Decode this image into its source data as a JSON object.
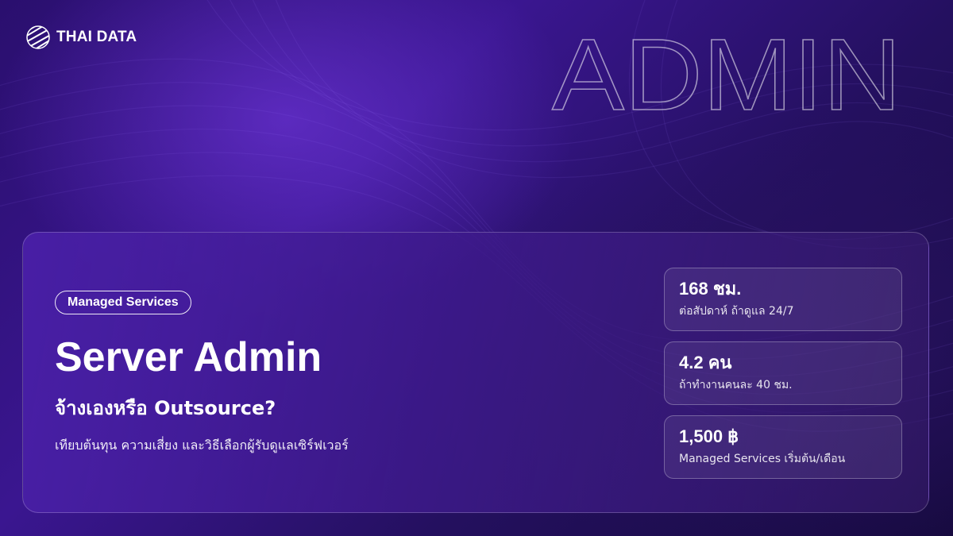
{
  "brand": {
    "name": "THAI DATA",
    "logo_icon": "globe-stripes-icon"
  },
  "watermark": {
    "text": "ADMIN"
  },
  "hero": {
    "tag": "Managed Services",
    "title": "Server Admin",
    "subtitle": "จ้างเองหรือ Outsource?",
    "description": "เทียบต้นทุน ความเสี่ยง และวิธีเลือกผู้รับดูแลเซิร์ฟเวอร์"
  },
  "stats": [
    {
      "value": "168 ชม.",
      "label": "ต่อสัปดาห์ ถ้าดูแล 24/7"
    },
    {
      "value": "4.2 คน",
      "label": "ถ้าทำงานคนละ 40 ชม."
    },
    {
      "value": "1,500 ฿",
      "label": "Managed Services เริ่มต้น/เดือน"
    }
  ],
  "colors": {
    "background": "#2a0f6e",
    "accent": "#7a3ceb",
    "text": "#ffffff"
  }
}
